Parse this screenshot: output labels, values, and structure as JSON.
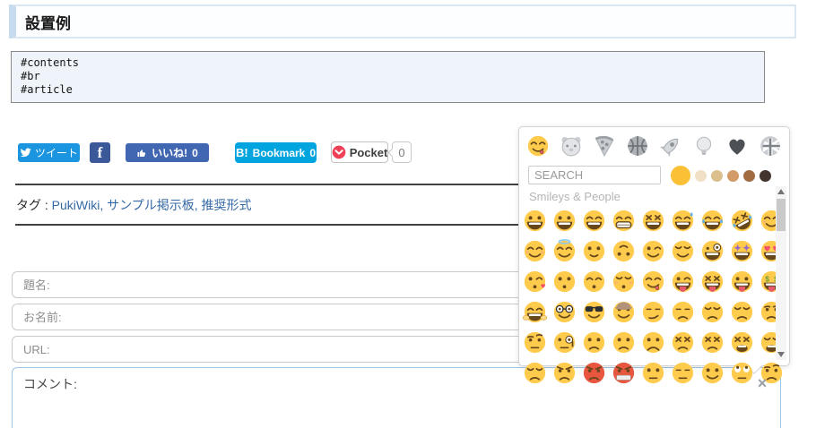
{
  "page": {
    "heading": "設置例"
  },
  "code_block": {
    "lines": [
      "#contents",
      "#br",
      "#article"
    ]
  },
  "share": {
    "tweet": {
      "label": "ツイート",
      "color": "#1b95e0"
    },
    "facebook": {
      "letter": "f",
      "color": "#3b5998"
    },
    "like": {
      "label": "いいね!",
      "count": "0",
      "color": "#4267b2"
    },
    "hatena": {
      "prefix": "B!",
      "label": "Bookmark",
      "count": "0",
      "color": "#00a4de"
    },
    "pocket": {
      "label": "Pocket",
      "count": "0",
      "logo_color": "#ee4056"
    }
  },
  "tags": {
    "label": "タグ :",
    "items": [
      "PukiWiki",
      "サンプル掲示板",
      "推奨形式"
    ],
    "link_color": "#3569a6"
  },
  "form": {
    "fields": [
      {
        "name": "subject",
        "placeholder": "題名:"
      },
      {
        "name": "name",
        "placeholder": "お名前:"
      },
      {
        "name": "url",
        "placeholder": "URL:"
      }
    ],
    "comment": {
      "placeholder": "コメント:"
    },
    "close_label": "×"
  },
  "emoji_picker": {
    "categories": [
      {
        "name": "smileys-people",
        "icon": "smiley",
        "active": true
      },
      {
        "name": "animals-nature",
        "icon": "hamster",
        "active": false
      },
      {
        "name": "food-drink",
        "icon": "pizza",
        "active": false
      },
      {
        "name": "activity",
        "icon": "basketball",
        "active": false
      },
      {
        "name": "travel-places",
        "icon": "rocket",
        "active": false
      },
      {
        "name": "objects",
        "icon": "lightbulb",
        "active": false
      },
      {
        "name": "symbols",
        "icon": "heart",
        "active": false
      },
      {
        "name": "flags",
        "icon": "flag",
        "active": false
      }
    ],
    "search_placeholder": "SEARCH",
    "skin_tones": [
      "#fac036",
      "#f1dfc6",
      "#dbc08e",
      "#d29b68",
      "#a26c43",
      "#43352e"
    ],
    "section_label": "Smileys & People",
    "emojis": [
      {
        "name": "grinning",
        "char": "😀"
      },
      {
        "name": "smiley",
        "char": "😃"
      },
      {
        "name": "smile",
        "char": "😄"
      },
      {
        "name": "grin",
        "char": "😁"
      },
      {
        "name": "laughing",
        "char": "😆"
      },
      {
        "name": "sweat-smile",
        "char": "😅"
      },
      {
        "name": "joy",
        "char": "😂"
      },
      {
        "name": "rofl",
        "char": "🤣"
      },
      {
        "name": "relaxed",
        "char": "☺️"
      },
      {
        "name": "blush",
        "char": "😊"
      },
      {
        "name": "innocent",
        "char": "😇"
      },
      {
        "name": "slightly-smiling",
        "char": "🙂"
      },
      {
        "name": "upside-down",
        "char": "🙃"
      },
      {
        "name": "wink",
        "char": "😉"
      },
      {
        "name": "relieved",
        "char": "😌"
      },
      {
        "name": "zany",
        "char": "🤪"
      },
      {
        "name": "star-struck",
        "char": "🤩"
      },
      {
        "name": "heart-eyes",
        "char": "😍"
      },
      {
        "name": "kissing-heart",
        "char": "😘"
      },
      {
        "name": "kissing",
        "char": "😗"
      },
      {
        "name": "kissing-smiling-eyes",
        "char": "😙"
      },
      {
        "name": "kissing-closed-eyes",
        "char": "😚"
      },
      {
        "name": "yum",
        "char": "😋"
      },
      {
        "name": "stuck-out-tongue-winking-eye",
        "char": "😜"
      },
      {
        "name": "stuck-out-tongue-closed-eyes",
        "char": "😝"
      },
      {
        "name": "stuck-out-tongue",
        "char": "😛"
      },
      {
        "name": "money-mouth",
        "char": "🤑"
      },
      {
        "name": "hugging",
        "char": "🤗"
      },
      {
        "name": "nerd",
        "char": "🤓"
      },
      {
        "name": "sunglasses",
        "char": "😎"
      },
      {
        "name": "cowboy",
        "char": "🤠"
      },
      {
        "name": "smirking",
        "char": "😏"
      },
      {
        "name": "unamused",
        "char": "😒"
      },
      {
        "name": "disappointed",
        "char": "😞"
      },
      {
        "name": "pensive",
        "char": "😔"
      },
      {
        "name": "worried",
        "char": "😟"
      },
      {
        "name": "raised-eyebrow",
        "char": "🤨"
      },
      {
        "name": "monocle",
        "char": "🧐"
      },
      {
        "name": "confused",
        "char": "😕"
      },
      {
        "name": "slightly-frowning",
        "char": "🙁"
      },
      {
        "name": "frowning",
        "char": "☹️"
      },
      {
        "name": "persevering",
        "char": "😣"
      },
      {
        "name": "confounded",
        "char": "😖"
      },
      {
        "name": "tired",
        "char": "😫"
      },
      {
        "name": "weary",
        "char": "😩"
      },
      {
        "name": "triumph",
        "char": "😤"
      },
      {
        "name": "angry",
        "char": "😠"
      },
      {
        "name": "rage",
        "char": "😡"
      },
      {
        "name": "cursing",
        "char": "🤬"
      },
      {
        "name": "neutral",
        "char": "😐"
      },
      {
        "name": "expressionless",
        "char": "😑"
      },
      {
        "name": "no-mouth",
        "char": "😶"
      },
      {
        "name": "rolling-eyes",
        "char": "🙄"
      },
      {
        "name": "thinking",
        "char": "🤔"
      }
    ]
  }
}
